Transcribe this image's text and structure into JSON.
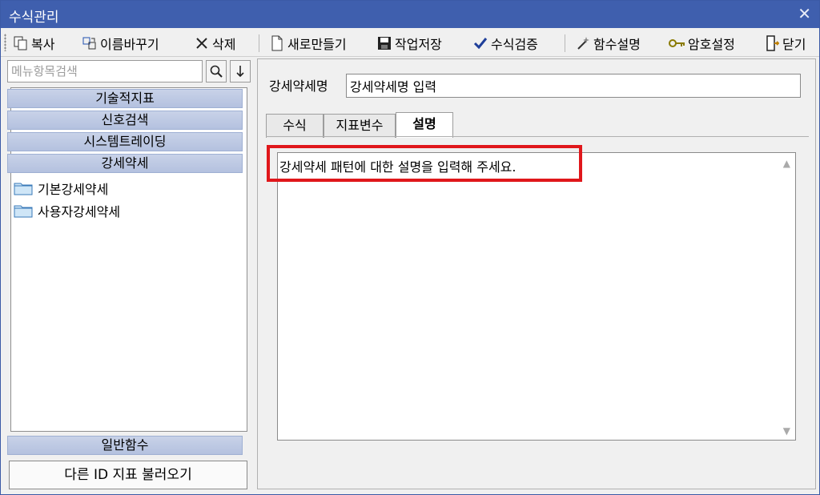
{
  "window": {
    "title": "수식관리",
    "close": "✕"
  },
  "toolbar": {
    "copy": "복사",
    "rename": "이름바꾸기",
    "delete": "삭제",
    "new": "새로만들기",
    "save": "작업저장",
    "verify": "수식검증",
    "func_help": "함수설명",
    "password": "암호설정",
    "close": "닫기"
  },
  "search": {
    "placeholder": "메뉴항목검색",
    "search_icon": "magnifier-icon",
    "down_icon": "arrow-down-icon"
  },
  "sidebar": {
    "categories": [
      "기술적지표",
      "신호검색",
      "시스템트레이딩",
      "강세약세"
    ],
    "folders": [
      "기본강세약세",
      "사용자강세약세"
    ],
    "bottom_category": "일반함수",
    "load_button": "다른 ID 지표 불러오기"
  },
  "main": {
    "name_label": "강세약세명",
    "name_value": "강세약세명 입력",
    "tabs": [
      "수식",
      "지표변수",
      "설명"
    ],
    "active_tab": "설명",
    "description": "강세약세 패턴에 대한 설명을 입력해 주세요."
  },
  "colors": {
    "titlebar": "#3f5fae",
    "category": "#b4c1df",
    "highlight": "#e0171b"
  }
}
